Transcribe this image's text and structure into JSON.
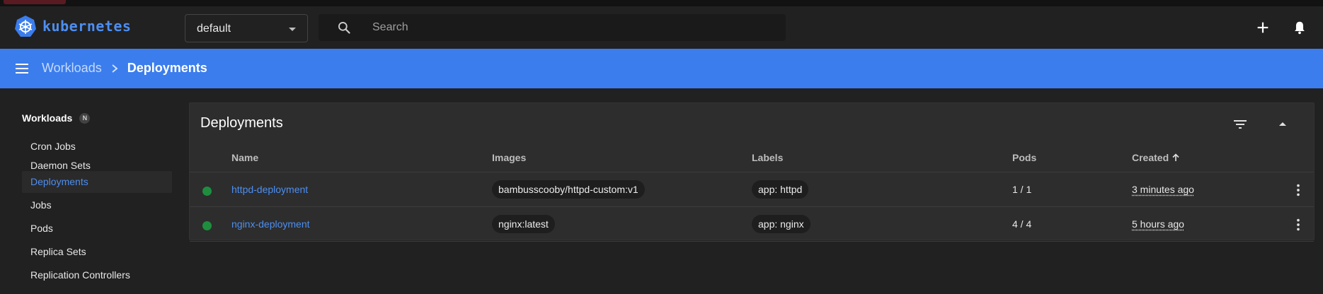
{
  "header": {
    "app_name": "kubernetes",
    "namespace": "default",
    "search_placeholder": "Search"
  },
  "toolbar": {
    "breadcrumb_parent": "Workloads",
    "breadcrumb_current": "Deployments"
  },
  "sidebar": {
    "section_title": "Workloads",
    "section_badge": "N",
    "items": [
      {
        "label": "Cron Jobs"
      },
      {
        "label": "Daemon Sets"
      },
      {
        "label": "Deployments"
      },
      {
        "label": "Jobs"
      },
      {
        "label": "Pods"
      },
      {
        "label": "Replica Sets"
      },
      {
        "label": "Replication Controllers"
      }
    ],
    "active_item": "Deployments"
  },
  "card": {
    "title": "Deployments",
    "columns": {
      "name": "Name",
      "images": "Images",
      "labels": "Labels",
      "pods": "Pods",
      "created": "Created"
    },
    "rows": [
      {
        "status": "running",
        "name": "httpd-deployment",
        "image": "bambusscooby/httpd-custom:v1",
        "label": "app: httpd",
        "pods": "1 / 1",
        "created": "3 minutes ago"
      },
      {
        "status": "running",
        "name": "nginx-deployment",
        "image": "nginx:latest",
        "label": "app: nginx",
        "pods": "4 / 4",
        "created": "5 hours ago"
      }
    ]
  },
  "colors": {
    "accent": "#3b7ded",
    "link": "#4d8ef0",
    "status_ok": "#1e8e3e",
    "background": "#212121",
    "card": "#2d2d2d"
  },
  "icons": [
    "kubernetes-logo",
    "search-icon",
    "add-icon",
    "bell-icon",
    "menu-icon",
    "chevron-right-icon",
    "filter-icon",
    "collapse-icon",
    "arrow-up-icon",
    "more-vert-icon"
  ]
}
